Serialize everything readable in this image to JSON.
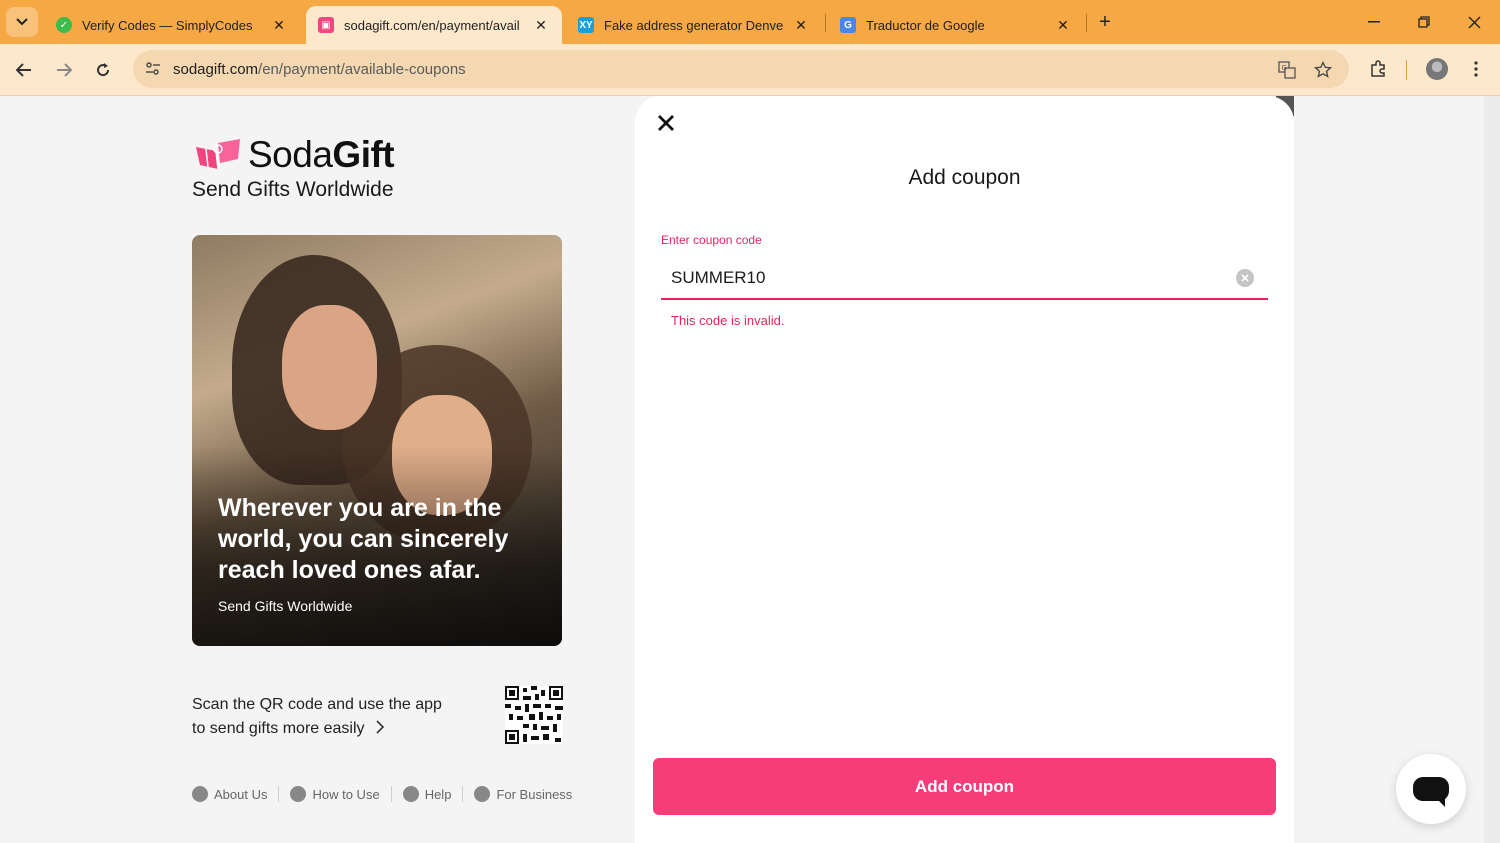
{
  "browser": {
    "tabs": [
      {
        "title": "Verify Codes — SimplyCodes",
        "favicon_color": "#3dbb4b"
      },
      {
        "title": "sodagift.com/en/payment/avail",
        "favicon_color": "#f0457e"
      },
      {
        "title": "Fake address generator Denver",
        "favicon_color": "#1a9fd6",
        "favicon_text": "XY"
      },
      {
        "title": "Traductor de Google",
        "favicon_color": "#4a86e8"
      }
    ],
    "url_domain": "sodagift.com",
    "url_path": "/en/payment/available-coupons"
  },
  "page": {
    "logo_text_regular": "Soda",
    "logo_text_bold": "Gift",
    "tagline": "Send Gifts Worldwide",
    "hero_text": "Wherever you are in the world, you can sincerely reach loved ones afar.",
    "hero_sub": "Send Gifts Worldwide",
    "qr_line1": "Scan the QR code and use the app",
    "qr_line2": "to send gifts more easily",
    "footer": [
      "About Us",
      "How to Use",
      "Help",
      "For Business"
    ]
  },
  "modal": {
    "title": "Add coupon",
    "field_label": "Enter coupon code",
    "input_value": "SUMMER10",
    "error": "This code is invalid.",
    "submit_label": "Add coupon"
  },
  "colors": {
    "accent": "#f73d79",
    "error": "#e8245e",
    "tabstrip": "#f6a844"
  }
}
